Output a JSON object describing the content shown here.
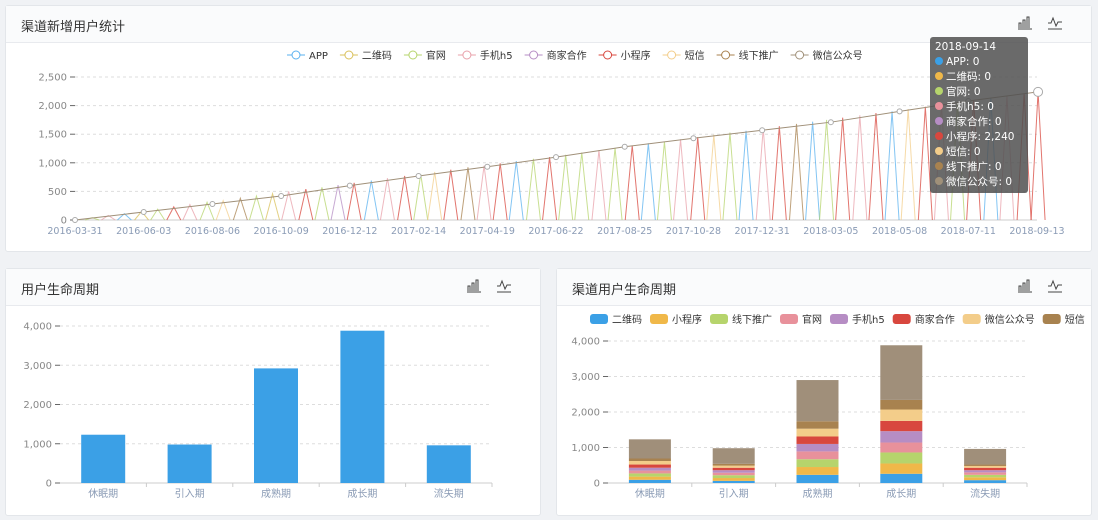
{
  "panels": {
    "top": {
      "title": "渠道新增用户统计"
    },
    "bottom_left": {
      "title": "用户生命周期"
    },
    "bottom_right": {
      "title": "渠道用户生命周期"
    }
  },
  "toolbar_icons": [
    "bar-chart-icon",
    "line-chart-icon"
  ],
  "tooltip": {
    "date": "2018-09-14",
    "rows": [
      {
        "label": "APP: 0",
        "color": "#3ba0e6"
      },
      {
        "label": "二维码: 0",
        "color": "#f0b849"
      },
      {
        "label": "官网: 0",
        "color": "#b6d46c"
      },
      {
        "label": "手机h5: 0",
        "color": "#e8919b"
      },
      {
        "label": "商家合作: 0",
        "color": "#b68dc4"
      },
      {
        "label": "小程序: 2,240",
        "color": "#d8473e"
      },
      {
        "label": "短信: 0",
        "color": "#f3cd8a"
      },
      {
        "label": "线下推广: 0",
        "color": "#a8824f"
      },
      {
        "label": "微信公众号: 0",
        "color": "#a09079"
      }
    ]
  },
  "chart_data": [
    {
      "type": "line",
      "legend_position": "top",
      "grid": true,
      "ylim": [
        0,
        2500
      ],
      "yticks": [
        0,
        500,
        1000,
        1500,
        2000,
        2500
      ],
      "ytick_labels": [
        "0",
        "500",
        "1,000",
        "1,500",
        "2,000",
        "2,500"
      ],
      "xtick_labels": [
        "2016-03-31",
        "2016-06-03",
        "2016-08-06",
        "2016-10-09",
        "2016-12-12",
        "2017-02-14",
        "2017-04-19",
        "2017-06-22",
        "2017-08-25",
        "2017-10-28",
        "2017-12-31",
        "2018-03-05",
        "2018-05-08",
        "2018-07-11",
        "2018-09-13"
      ],
      "series": [
        {
          "name": "APP",
          "color": "#5ab1ef"
        },
        {
          "name": "二维码",
          "color": "#d9c05a"
        },
        {
          "name": "官网",
          "color": "#b6d46c"
        },
        {
          "name": "手机h5",
          "color": "#e8a0aa"
        },
        {
          "name": "商家合作",
          "color": "#b68dc4"
        },
        {
          "name": "小程序",
          "color": "#d8473e"
        },
        {
          "name": "短信",
          "color": "#f3cd8a"
        },
        {
          "name": "线下推广",
          "color": "#a8824f"
        },
        {
          "name": "微信公众号",
          "color": "#a09079"
        }
      ],
      "envelope": {
        "series": "微信公众号",
        "points": [
          [
            "2016-03-31",
            0
          ],
          [
            "2016-06-03",
            140
          ],
          [
            "2016-08-06",
            280
          ],
          [
            "2016-10-09",
            420
          ],
          [
            "2016-12-12",
            600
          ],
          [
            "2017-02-14",
            770
          ],
          [
            "2017-04-19",
            930
          ],
          [
            "2017-06-22",
            1100
          ],
          [
            "2017-08-25",
            1280
          ],
          [
            "2017-10-28",
            1430
          ],
          [
            "2017-12-31",
            1570
          ],
          [
            "2018-03-05",
            1710
          ],
          [
            "2018-05-08",
            1900
          ],
          [
            "2018-07-11",
            2080
          ],
          [
            "2018-09-14",
            2240
          ]
        ]
      },
      "spikes": [
        [
          "2016-04-16",
          "官网",
          40
        ],
        [
          "2016-05-01",
          "手机h5",
          80
        ],
        [
          "2016-05-16",
          "APP",
          110
        ],
        [
          "2016-06-01",
          "二维码",
          150
        ],
        [
          "2016-06-16",
          "官网",
          190
        ],
        [
          "2016-07-01",
          "小程序",
          230
        ],
        [
          "2016-07-16",
          "手机h5",
          270
        ],
        [
          "2016-08-01",
          "官网",
          310
        ],
        [
          "2016-08-16",
          "短信",
          340
        ],
        [
          "2016-09-01",
          "线下推广",
          380
        ],
        [
          "2016-09-16",
          "官网",
          420
        ],
        [
          "2016-10-01",
          "二维码",
          460
        ],
        [
          "2016-10-16",
          "手机h5",
          500
        ],
        [
          "2016-11-01",
          "小程序",
          540
        ],
        [
          "2016-11-16",
          "官网",
          570
        ],
        [
          "2016-12-01",
          "商家合作",
          610
        ],
        [
          "2016-12-16",
          "小程序",
          650
        ],
        [
          "2017-01-01",
          "APP",
          690
        ],
        [
          "2017-01-16",
          "手机h5",
          730
        ],
        [
          "2017-02-01",
          "小程序",
          770
        ],
        [
          "2017-02-16",
          "官网",
          800
        ],
        [
          "2017-03-01",
          "短信",
          840
        ],
        [
          "2017-03-16",
          "小程序",
          880
        ],
        [
          "2017-04-01",
          "线下推广",
          920
        ],
        [
          "2017-04-16",
          "手机h5",
          950
        ],
        [
          "2017-05-01",
          "小程序",
          990
        ],
        [
          "2017-05-16",
          "APP",
          1030
        ],
        [
          "2017-06-01",
          "官网",
          1070
        ],
        [
          "2017-06-16",
          "小程序",
          1100
        ],
        [
          "2017-07-01",
          "官网",
          1140
        ],
        [
          "2017-07-16",
          "官网",
          1180
        ],
        [
          "2017-08-01",
          "手机h5",
          1220
        ],
        [
          "2017-08-16",
          "官网",
          1260
        ],
        [
          "2017-09-01",
          "小程序",
          1300
        ],
        [
          "2017-09-16",
          "APP",
          1340
        ],
        [
          "2017-10-01",
          "官网",
          1370
        ],
        [
          "2017-10-16",
          "手机h5",
          1410
        ],
        [
          "2017-11-01",
          "小程序",
          1450
        ],
        [
          "2017-11-16",
          "短信",
          1490
        ],
        [
          "2017-12-01",
          "官网",
          1530
        ],
        [
          "2017-12-16",
          "APP",
          1560
        ],
        [
          "2018-01-01",
          "手机h5",
          1600
        ],
        [
          "2018-01-16",
          "小程序",
          1640
        ],
        [
          "2018-02-01",
          "线下推广",
          1680
        ],
        [
          "2018-02-16",
          "APP",
          1720
        ],
        [
          "2018-03-01",
          "官网",
          1750
        ],
        [
          "2018-03-16",
          "小程序",
          1790
        ],
        [
          "2018-04-01",
          "手机h5",
          1830
        ],
        [
          "2018-04-16",
          "小程序",
          1870
        ],
        [
          "2018-05-01",
          "APP",
          1900
        ],
        [
          "2018-05-16",
          "短信",
          1940
        ],
        [
          "2018-06-01",
          "小程序",
          1980
        ],
        [
          "2018-06-16",
          "手机h5",
          2020
        ],
        [
          "2018-07-01",
          "官网",
          2060
        ],
        [
          "2018-07-16",
          "小程序",
          2090
        ],
        [
          "2018-08-01",
          "APP",
          2130
        ],
        [
          "2018-08-16",
          "手机h5",
          2170
        ],
        [
          "2018-09-01",
          "小程序",
          2210
        ],
        [
          "2018-09-14",
          "小程序",
          2240
        ]
      ]
    },
    {
      "type": "bar",
      "grid": true,
      "ylim": [
        0,
        4000
      ],
      "yticks": [
        0,
        1000,
        2000,
        3000,
        4000
      ],
      "ytick_labels": [
        "0",
        "1,000",
        "2,000",
        "3,000",
        "4,000"
      ],
      "categories": [
        "休眠期",
        "引入期",
        "成熟期",
        "成长期",
        "流失期"
      ],
      "values": [
        1230,
        980,
        2920,
        3880,
        960
      ],
      "color": "#3ba0e6"
    },
    {
      "type": "bar",
      "stacked": true,
      "legend_position": "top",
      "grid": true,
      "ylim": [
        0,
        4000
      ],
      "yticks": [
        0,
        1000,
        2000,
        3000,
        4000
      ],
      "ytick_labels": [
        "0",
        "1,000",
        "2,000",
        "3,000",
        "4,000"
      ],
      "categories": [
        "休眠期",
        "引入期",
        "成熟期",
        "成长期",
        "流失期"
      ],
      "series": [
        {
          "name": "二维码",
          "color": "#3ba0e6",
          "values": [
            90,
            60,
            230,
            260,
            80
          ]
        },
        {
          "name": "小程序",
          "color": "#f0b849",
          "values": [
            90,
            80,
            220,
            290,
            80
          ]
        },
        {
          "name": "线下推广",
          "color": "#b6d46c",
          "values": [
            90,
            80,
            220,
            310,
            70
          ]
        },
        {
          "name": "官网",
          "color": "#e8919b",
          "values": [
            80,
            70,
            220,
            280,
            70
          ]
        },
        {
          "name": "手机h5",
          "color": "#b68dc4",
          "values": [
            80,
            70,
            210,
            320,
            60
          ]
        },
        {
          "name": "商家合作",
          "color": "#d8473e",
          "values": [
            90,
            70,
            210,
            290,
            70
          ]
        },
        {
          "name": "微信公众号",
          "color": "#f3cd8a",
          "values": [
            100,
            60,
            220,
            320,
            50
          ]
        },
        {
          "name": "短信",
          "color": "#a8824f",
          "values": [
            70,
            50,
            210,
            270,
            40
          ]
        },
        {
          "color": "#a08f7a",
          "values": [
            540,
            440,
            1160,
            1540,
            440
          ]
        }
      ]
    }
  ]
}
